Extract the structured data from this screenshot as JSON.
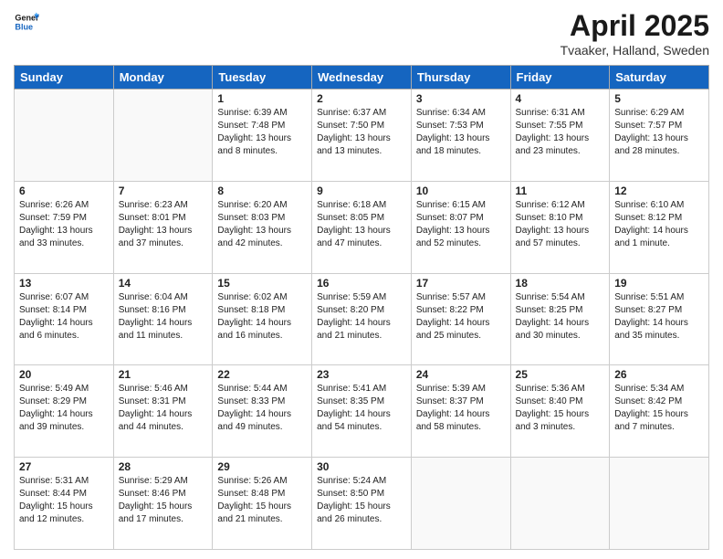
{
  "header": {
    "logo_line1": "General",
    "logo_line2": "Blue",
    "month": "April 2025",
    "location": "Tvaaker, Halland, Sweden"
  },
  "days_of_week": [
    "Sunday",
    "Monday",
    "Tuesday",
    "Wednesday",
    "Thursday",
    "Friday",
    "Saturday"
  ],
  "weeks": [
    [
      {
        "day": "",
        "info": ""
      },
      {
        "day": "",
        "info": ""
      },
      {
        "day": "1",
        "info": "Sunrise: 6:39 AM\nSunset: 7:48 PM\nDaylight: 13 hours\nand 8 minutes."
      },
      {
        "day": "2",
        "info": "Sunrise: 6:37 AM\nSunset: 7:50 PM\nDaylight: 13 hours\nand 13 minutes."
      },
      {
        "day": "3",
        "info": "Sunrise: 6:34 AM\nSunset: 7:53 PM\nDaylight: 13 hours\nand 18 minutes."
      },
      {
        "day": "4",
        "info": "Sunrise: 6:31 AM\nSunset: 7:55 PM\nDaylight: 13 hours\nand 23 minutes."
      },
      {
        "day": "5",
        "info": "Sunrise: 6:29 AM\nSunset: 7:57 PM\nDaylight: 13 hours\nand 28 minutes."
      }
    ],
    [
      {
        "day": "6",
        "info": "Sunrise: 6:26 AM\nSunset: 7:59 PM\nDaylight: 13 hours\nand 33 minutes."
      },
      {
        "day": "7",
        "info": "Sunrise: 6:23 AM\nSunset: 8:01 PM\nDaylight: 13 hours\nand 37 minutes."
      },
      {
        "day": "8",
        "info": "Sunrise: 6:20 AM\nSunset: 8:03 PM\nDaylight: 13 hours\nand 42 minutes."
      },
      {
        "day": "9",
        "info": "Sunrise: 6:18 AM\nSunset: 8:05 PM\nDaylight: 13 hours\nand 47 minutes."
      },
      {
        "day": "10",
        "info": "Sunrise: 6:15 AM\nSunset: 8:07 PM\nDaylight: 13 hours\nand 52 minutes."
      },
      {
        "day": "11",
        "info": "Sunrise: 6:12 AM\nSunset: 8:10 PM\nDaylight: 13 hours\nand 57 minutes."
      },
      {
        "day": "12",
        "info": "Sunrise: 6:10 AM\nSunset: 8:12 PM\nDaylight: 14 hours\nand 1 minute."
      }
    ],
    [
      {
        "day": "13",
        "info": "Sunrise: 6:07 AM\nSunset: 8:14 PM\nDaylight: 14 hours\nand 6 minutes."
      },
      {
        "day": "14",
        "info": "Sunrise: 6:04 AM\nSunset: 8:16 PM\nDaylight: 14 hours\nand 11 minutes."
      },
      {
        "day": "15",
        "info": "Sunrise: 6:02 AM\nSunset: 8:18 PM\nDaylight: 14 hours\nand 16 minutes."
      },
      {
        "day": "16",
        "info": "Sunrise: 5:59 AM\nSunset: 8:20 PM\nDaylight: 14 hours\nand 21 minutes."
      },
      {
        "day": "17",
        "info": "Sunrise: 5:57 AM\nSunset: 8:22 PM\nDaylight: 14 hours\nand 25 minutes."
      },
      {
        "day": "18",
        "info": "Sunrise: 5:54 AM\nSunset: 8:25 PM\nDaylight: 14 hours\nand 30 minutes."
      },
      {
        "day": "19",
        "info": "Sunrise: 5:51 AM\nSunset: 8:27 PM\nDaylight: 14 hours\nand 35 minutes."
      }
    ],
    [
      {
        "day": "20",
        "info": "Sunrise: 5:49 AM\nSunset: 8:29 PM\nDaylight: 14 hours\nand 39 minutes."
      },
      {
        "day": "21",
        "info": "Sunrise: 5:46 AM\nSunset: 8:31 PM\nDaylight: 14 hours\nand 44 minutes."
      },
      {
        "day": "22",
        "info": "Sunrise: 5:44 AM\nSunset: 8:33 PM\nDaylight: 14 hours\nand 49 minutes."
      },
      {
        "day": "23",
        "info": "Sunrise: 5:41 AM\nSunset: 8:35 PM\nDaylight: 14 hours\nand 54 minutes."
      },
      {
        "day": "24",
        "info": "Sunrise: 5:39 AM\nSunset: 8:37 PM\nDaylight: 14 hours\nand 58 minutes."
      },
      {
        "day": "25",
        "info": "Sunrise: 5:36 AM\nSunset: 8:40 PM\nDaylight: 15 hours\nand 3 minutes."
      },
      {
        "day": "26",
        "info": "Sunrise: 5:34 AM\nSunset: 8:42 PM\nDaylight: 15 hours\nand 7 minutes."
      }
    ],
    [
      {
        "day": "27",
        "info": "Sunrise: 5:31 AM\nSunset: 8:44 PM\nDaylight: 15 hours\nand 12 minutes."
      },
      {
        "day": "28",
        "info": "Sunrise: 5:29 AM\nSunset: 8:46 PM\nDaylight: 15 hours\nand 17 minutes."
      },
      {
        "day": "29",
        "info": "Sunrise: 5:26 AM\nSunset: 8:48 PM\nDaylight: 15 hours\nand 21 minutes."
      },
      {
        "day": "30",
        "info": "Sunrise: 5:24 AM\nSunset: 8:50 PM\nDaylight: 15 hours\nand 26 minutes."
      },
      {
        "day": "",
        "info": ""
      },
      {
        "day": "",
        "info": ""
      },
      {
        "day": "",
        "info": ""
      }
    ]
  ]
}
